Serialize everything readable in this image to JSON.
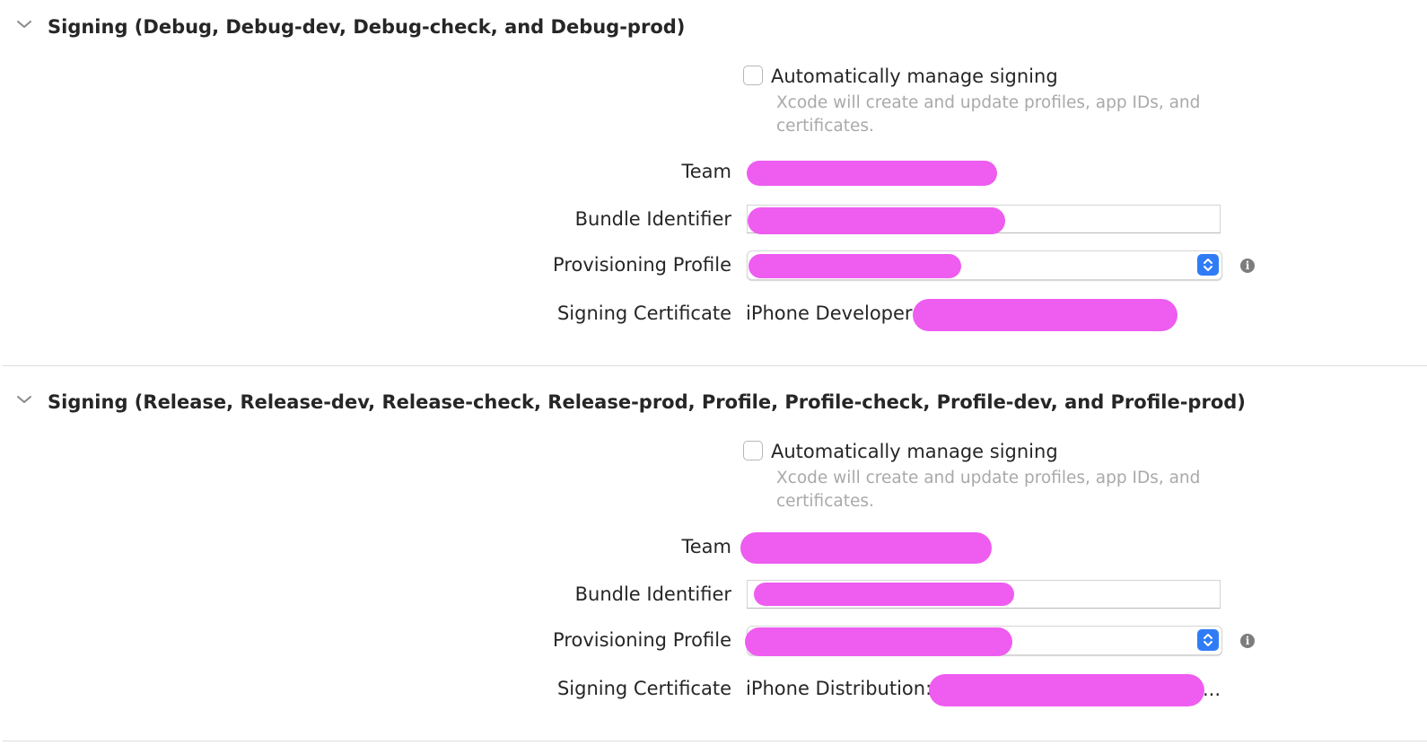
{
  "sections": [
    {
      "title": "Signing (Debug, Debug-dev, Debug-check, and Debug-prod)",
      "auto_manage_label": "Automatically manage signing",
      "auto_manage_help": "Xcode will create and update profiles, app IDs, and certificates.",
      "team_label": "Team",
      "bundle_label": "Bundle Identifier",
      "profile_label": "Provisioning Profile",
      "cert_label": "Signing Certificate",
      "cert_value": "iPhone Developer:"
    },
    {
      "title": "Signing (Release, Release-dev, Release-check, Release-prod, Profile, Profile-check, Profile-dev, and Profile-prod)",
      "auto_manage_label": "Automatically manage signing",
      "auto_manage_help": "Xcode will create and update profiles, app IDs, and certificates.",
      "team_label": "Team",
      "bundle_label": "Bundle Identifier",
      "profile_label": "Provisioning Profile",
      "cert_label": "Signing Certificate",
      "cert_value": "iPhone Distribution:",
      "cert_ellipsis": "..."
    }
  ],
  "icons": {
    "disclosure": "chevron-down-icon",
    "stepper": "popup-stepper-icon",
    "info": "info-icon"
  },
  "colors": {
    "accent": "#2f7cf6",
    "redaction": "#ee5cf0",
    "help_text": "#a9a9a9"
  }
}
